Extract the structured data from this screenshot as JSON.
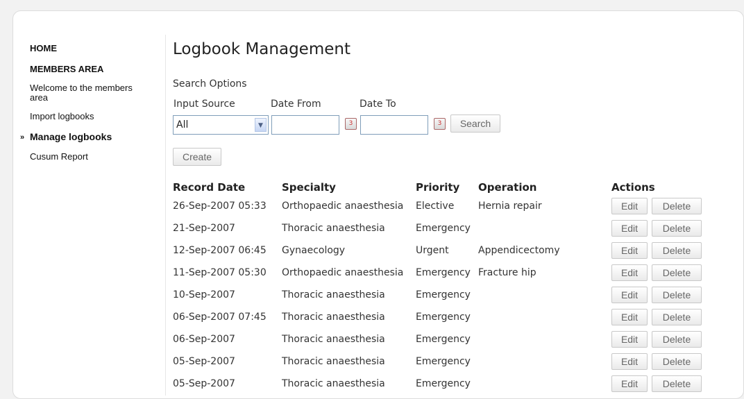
{
  "sidebar": {
    "home": "HOME",
    "members_area": "MEMBERS AREA",
    "welcome": "Welcome to the members area",
    "import": "Import logbooks",
    "manage": "Manage logbooks",
    "cusum": "Cusum Report",
    "active_marker": "»"
  },
  "page": {
    "title": "Logbook Management"
  },
  "search": {
    "heading": "Search Options",
    "input_source_label": "Input Source",
    "date_from_label": "Date From",
    "date_to_label": "Date To",
    "input_source_value": "All",
    "date_from_value": "",
    "date_to_value": "",
    "search_button": "Search",
    "calendar_glyph": "3"
  },
  "create_button": "Create",
  "table": {
    "headers": {
      "record_date": "Record Date",
      "specialty": "Specialty",
      "priority": "Priority",
      "operation": "Operation",
      "actions": "Actions"
    },
    "edit_label": "Edit",
    "delete_label": "Delete",
    "rows": [
      {
        "date": "26-Sep-2007 05:33",
        "specialty": "Orthopaedic anaesthesia",
        "priority": "Elective",
        "operation": "Hernia repair"
      },
      {
        "date": "21-Sep-2007",
        "specialty": "Thoracic anaesthesia",
        "priority": "Emergency",
        "operation": ""
      },
      {
        "date": "12-Sep-2007 06:45",
        "specialty": "Gynaecology",
        "priority": "Urgent",
        "operation": "Appendicectomy"
      },
      {
        "date": "11-Sep-2007 05:30",
        "specialty": "Orthopaedic anaesthesia",
        "priority": "Emergency",
        "operation": "Fracture hip"
      },
      {
        "date": "10-Sep-2007",
        "specialty": "Thoracic anaesthesia",
        "priority": "Emergency",
        "operation": ""
      },
      {
        "date": "06-Sep-2007 07:45",
        "specialty": "Thoracic anaesthesia",
        "priority": "Emergency",
        "operation": ""
      },
      {
        "date": "06-Sep-2007",
        "specialty": "Thoracic anaesthesia",
        "priority": "Emergency",
        "operation": ""
      },
      {
        "date": "05-Sep-2007",
        "specialty": "Thoracic anaesthesia",
        "priority": "Emergency",
        "operation": ""
      },
      {
        "date": "05-Sep-2007",
        "specialty": "Thoracic anaesthesia",
        "priority": "Emergency",
        "operation": ""
      }
    ]
  }
}
